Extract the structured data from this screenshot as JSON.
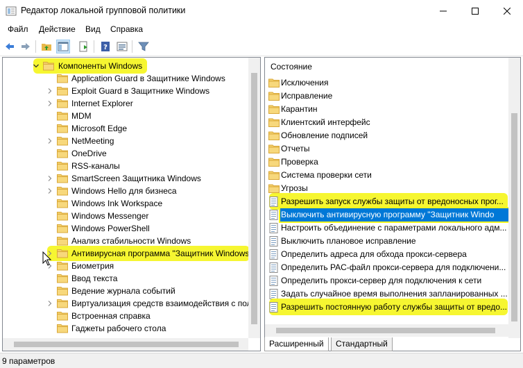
{
  "window": {
    "title": "Редактор локальной групповой политики"
  },
  "menu": [
    "Файл",
    "Действие",
    "Вид",
    "Справка"
  ],
  "toolbar": {
    "icons": [
      "back-arrow-icon",
      "forward-arrow-icon",
      "up-folder-icon",
      "show-hide-tree-icon",
      "export-list-icon",
      "help-icon",
      "properties-icon",
      "filter-icon"
    ]
  },
  "tree": {
    "items": [
      {
        "label": "Компоненты Windows",
        "expander": "open",
        "highlight": true
      },
      {
        "label": "Application Guard в Защитнике Windows",
        "expander": "none"
      },
      {
        "label": "Exploit Guard в Защитнике Windows",
        "expander": "closed"
      },
      {
        "label": "Internet Explorer",
        "expander": "closed"
      },
      {
        "label": "MDM",
        "expander": "none"
      },
      {
        "label": "Microsoft Edge",
        "expander": "none"
      },
      {
        "label": "NetMeeting",
        "expander": "closed"
      },
      {
        "label": "OneDrive",
        "expander": "none"
      },
      {
        "label": "RSS-каналы",
        "expander": "none"
      },
      {
        "label": "SmartScreen Защитника Windows",
        "expander": "closed"
      },
      {
        "label": "Windows Hello для бизнеса",
        "expander": "closed"
      },
      {
        "label": "Windows Ink Workspace",
        "expander": "none"
      },
      {
        "label": "Windows Messenger",
        "expander": "none"
      },
      {
        "label": "Windows PowerShell",
        "expander": "none"
      },
      {
        "label": "Анализ стабильности Windows",
        "expander": "none"
      },
      {
        "label": "Антивирусная программа \"Защитник Windows\"",
        "expander": "closed",
        "highlight": true
      },
      {
        "label": "Биометрия",
        "expander": "closed"
      },
      {
        "label": "Ввод текста",
        "expander": "none"
      },
      {
        "label": "Ведение журнала событий",
        "expander": "none"
      },
      {
        "label": "Виртуализация средств взаимодействия с пользователем",
        "expander": "closed"
      },
      {
        "label": "Встроенная справка",
        "expander": "none"
      },
      {
        "label": "Гаджеты рабочего стола",
        "expander": "none"
      }
    ]
  },
  "list": {
    "header": "Состояние",
    "rows": [
      {
        "label": "Исключения",
        "kind": "folder"
      },
      {
        "label": "Исправление",
        "kind": "folder"
      },
      {
        "label": "Карантин",
        "kind": "folder"
      },
      {
        "label": "Клиентский интерфейс",
        "kind": "folder"
      },
      {
        "label": "Обновление подписей",
        "kind": "folder"
      },
      {
        "label": "Отчеты",
        "kind": "folder"
      },
      {
        "label": "Проверка",
        "kind": "folder"
      },
      {
        "label": "Система проверки сети",
        "kind": "folder"
      },
      {
        "label": "Угрозы",
        "kind": "folder"
      },
      {
        "label": "Разрешить запуск службы защиты от вредоносных прог...",
        "kind": "setting",
        "highlight": true
      },
      {
        "label": "Выключить антивирусную программу \"Защитник Windo",
        "kind": "setting",
        "selected": true
      },
      {
        "label": "Настроить объединение с параметрами локального адм...",
        "kind": "setting"
      },
      {
        "label": "Выключить плановое исправление",
        "kind": "setting"
      },
      {
        "label": "Определить адреса для обхода прокси-сервера",
        "kind": "setting"
      },
      {
        "label": "Определить PAC-файл прокси-сервера для подключени...",
        "kind": "setting"
      },
      {
        "label": "Определить прокси-сервер для подключения к сети",
        "kind": "setting"
      },
      {
        "label": "Задать случайное время выполнения запланированных ...",
        "kind": "setting"
      },
      {
        "label": "Разрешить постоянную работу службы защиты от вредо...",
        "kind": "setting",
        "highlight": true
      }
    ]
  },
  "tabs": [
    "Расширенный",
    "Стандартный"
  ],
  "status": {
    "text": "9 параметров"
  },
  "colors": {
    "highlight": "#f5f520",
    "selection": "#0078d7",
    "folder": "#f0c75e"
  }
}
